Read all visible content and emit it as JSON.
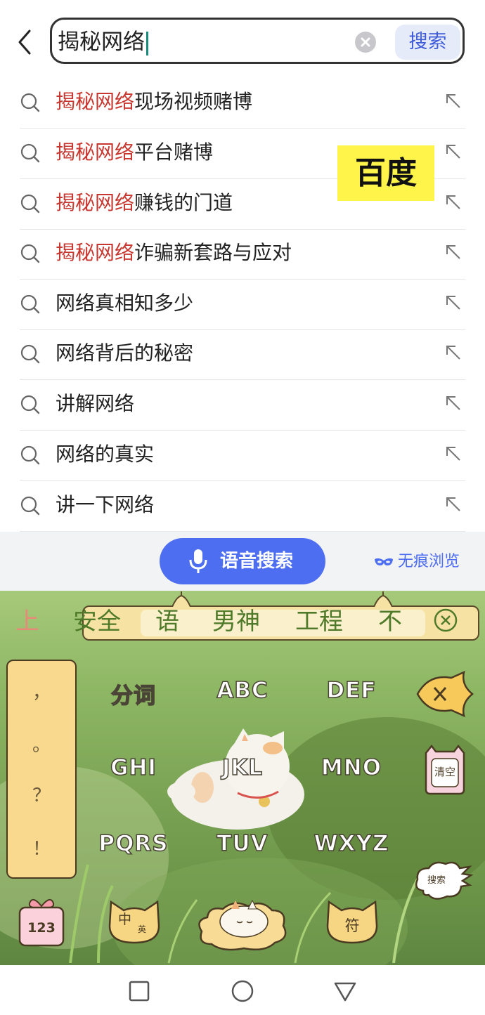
{
  "search": {
    "query": "揭秘网络",
    "button_label": "搜索"
  },
  "suggestions": [
    {
      "highlight": "揭秘网络",
      "rest": "现场视频赌博"
    },
    {
      "highlight": "揭秘网络",
      "rest": "平台赌博"
    },
    {
      "highlight": "揭秘网络",
      "rest": "赚钱的门道"
    },
    {
      "highlight": "揭秘网络",
      "rest": "诈骗新套路与应对"
    },
    {
      "highlight": "",
      "rest": "网络真相知多少"
    },
    {
      "highlight": "",
      "rest": "网络背后的秘密"
    },
    {
      "highlight": "",
      "rest": "讲解网络"
    },
    {
      "highlight": "",
      "rest": "网络的真实"
    },
    {
      "highlight": "",
      "rest": "讲一下网络"
    }
  ],
  "watermark": "百度",
  "voice_search_label": "语音搜索",
  "incognito_label": "无痕浏览",
  "keyboard": {
    "candidates": [
      "上",
      "安全",
      "语",
      "男神",
      "工程",
      "不好"
    ],
    "punctuation": [
      "，",
      "。",
      "？",
      "！"
    ],
    "keys_row1": [
      "分词",
      "ABC",
      "DEF"
    ],
    "keys_row2": [
      "GHI",
      "JKL",
      "MNO"
    ],
    "keys_row3": [
      "PQRS",
      "TUV",
      "WXYZ"
    ],
    "clear_label": "清空",
    "search_label": "搜索",
    "num_label": "123",
    "lang_label_top": "中",
    "lang_label_bottom": "英",
    "symbol_label": "符"
  },
  "colors": {
    "accent": "#4e6ef2",
    "highlight": "#c8372f"
  }
}
